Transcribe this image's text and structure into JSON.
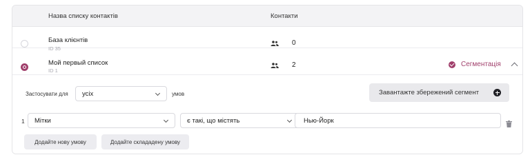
{
  "table": {
    "col_name": "Назва списку контактів",
    "col_contacts": "Контакти"
  },
  "lists": [
    {
      "name": "База клієнтів",
      "id": "ID 35",
      "count": "0",
      "selected": false
    },
    {
      "name": "Мой первый список",
      "id": "ID 1",
      "count": "2",
      "selected": true
    }
  ],
  "segmentation": {
    "label": "Сегментація"
  },
  "builder": {
    "apply_label": "Застосувати для",
    "apply_value": "усіх",
    "conditions_label": "умов",
    "load_segment_label": "Завантажте збережений сегмент",
    "row_number": "1",
    "field_value": "Мітки",
    "operator_value": "є такі, що містять",
    "input_value": "Нью-Йорк",
    "add_condition_label": "Додайте нову умову",
    "add_complex_condition_label": "Додайте склададену умову"
  },
  "colors": {
    "accent": "#a03f6b"
  },
  "icons": [
    "people-icon",
    "check-circle-icon",
    "chevron-up-icon",
    "chevron-down-icon",
    "plus-circle-icon",
    "trash-icon"
  ]
}
